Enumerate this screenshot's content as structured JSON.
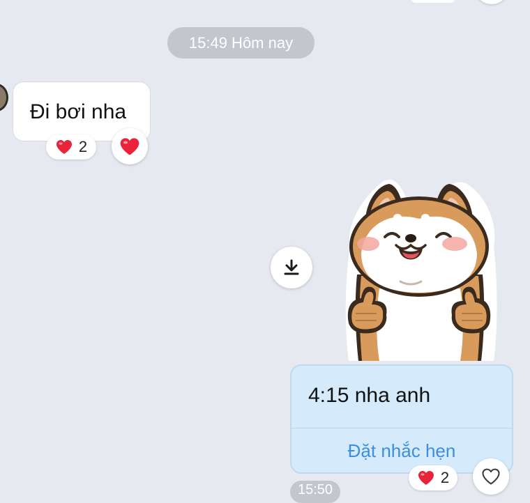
{
  "date_separator": "15:49 Hôm nay",
  "incoming_message": {
    "text": "Đi bơi nha",
    "reaction_count": "2",
    "reaction_icon": "heart-icon",
    "reaction_button_icon": "heart-icon"
  },
  "sticker": {
    "download_icon": "download-icon",
    "description_icon": "shiba-dog-thumbs-up-sticker"
  },
  "outgoing_message": {
    "text": "4:15 nha anh",
    "action_label": "Đặt nhắc hẹn",
    "reaction_count": "2",
    "reaction_icon": "heart-icon",
    "reaction_button_icon": "heart-outline-icon",
    "time": "15:50"
  },
  "colors": {
    "background": "#e6e9f0",
    "outgoing_bubble": "#d5ebfb",
    "link_blue": "#3d8fdb",
    "heart_red": "#e8243b",
    "pill_gray": "#c3c6cc"
  }
}
